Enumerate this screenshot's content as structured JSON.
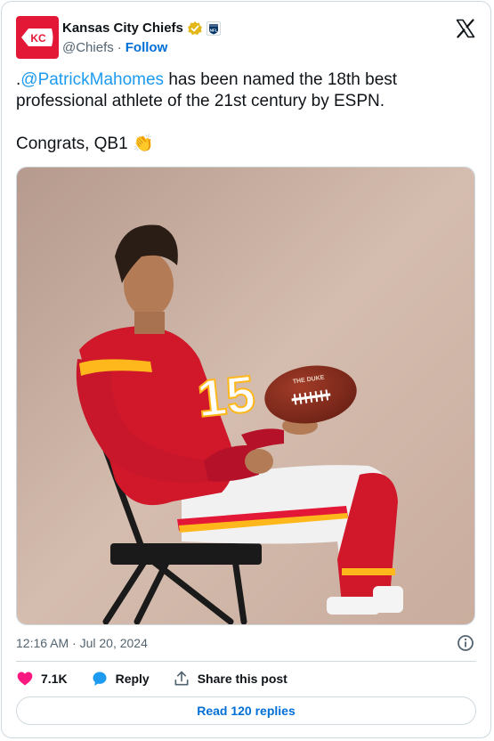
{
  "account": {
    "display_name": "Kansas City Chiefs",
    "handle": "@Chiefs",
    "separator": "·",
    "follow_label": "Follow",
    "avatar_text": "KC",
    "nfl_badge_text": "NFL"
  },
  "tweet": {
    "prefix": ".",
    "mention": "@PatrickMahomes",
    "text_after_mention": " has been named the 18th best professional athlete of the 21st century by ESPN.",
    "second_line": "Congrats, QB1",
    "emoji": "👏",
    "football_text": "THE DUKE",
    "jersey_number": "15"
  },
  "meta": {
    "timestamp": "12:16 AM · Jul 20, 2024"
  },
  "actions": {
    "likes": "7.1K",
    "reply_label": "Reply",
    "share_label": "Share this post"
  },
  "read_replies_label": "Read 120 replies",
  "colors": {
    "chiefs_red": "#e31837",
    "link_blue": "#1d9bf0",
    "follow_blue": "#006fd6",
    "like_pink": "#f91880",
    "reply_blue": "#1d9bf0",
    "muted": "#536471"
  }
}
